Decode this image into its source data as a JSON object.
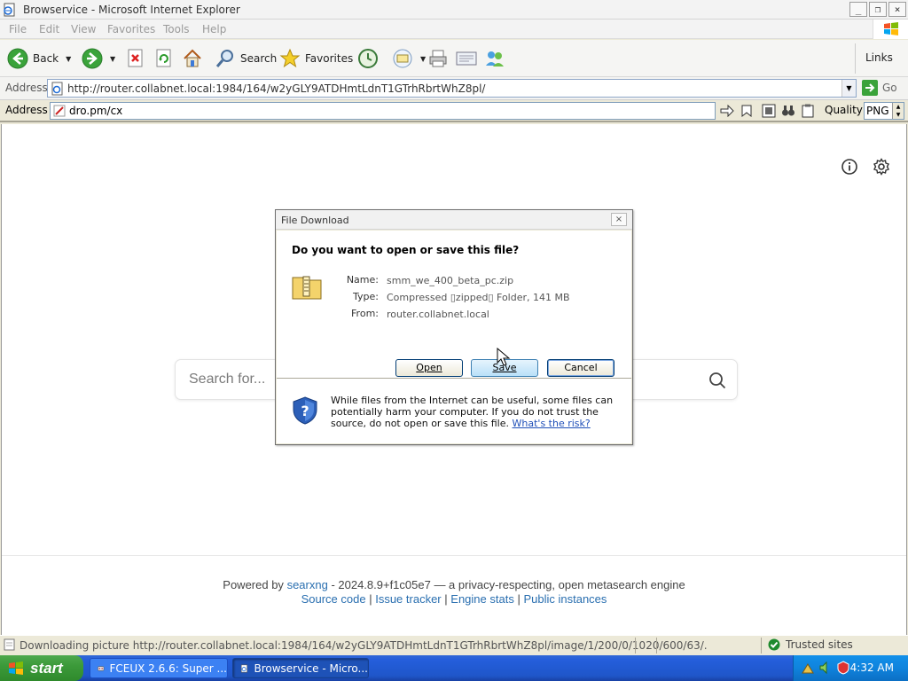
{
  "window": {
    "title": "Browservice - Microsoft Internet Explorer",
    "controls": {
      "minimize": "_",
      "restore": "❐",
      "close": "×"
    }
  },
  "menu": {
    "items": [
      "File",
      "Edit",
      "View",
      "Favorites",
      "Tools",
      "Help"
    ]
  },
  "toolbar": {
    "back_label": "Back",
    "search_label": "Search",
    "favorites_label": "Favorites",
    "links_label": "Links"
  },
  "address_bar": {
    "label": "Address",
    "url": "http://router.collabnet.local:1984/164/w2yGLY9ATDHmtLdnT1GTrhRbrtWhZ8pl/",
    "go_label": "Go"
  },
  "proxy_bar": {
    "label": "Address",
    "url": "dro.pm/cx",
    "quality_label": "Quality",
    "quality_value": "PNG"
  },
  "page": {
    "search_placeholder": "Search for...",
    "footer": {
      "powered_by": "Powered by",
      "engine_link": "searxng",
      "version_text": "- 2024.8.9+f1c05e7 — a privacy-respecting, open metasearch engine",
      "links": [
        "Source code",
        "Issue tracker",
        "Engine stats",
        "Public instances"
      ],
      "separator": "|"
    }
  },
  "dialog": {
    "title": "File Download",
    "question": "Do you want to open or save this file?",
    "fields": {
      "name_label": "Name:",
      "name_value": "smm_we_400_beta_pc.zip",
      "type_label": "Type:",
      "type_value": "Compressed ▯zipped▯ Folder, 141 MB",
      "from_label": "From:",
      "from_value": "router.collabnet.local"
    },
    "buttons": {
      "open": "Open",
      "save": "Save",
      "cancel": "Cancel"
    },
    "warning": "While files from the Internet can be useful, some files can potentially harm your computer. If you do not trust the source, do not open or save this file.",
    "risk_link": "What's the risk?"
  },
  "status_bar": {
    "text": "Downloading picture http://router.collabnet.local:1984/164/w2yGLY9ATDHmtLdnT1GTrhRbrtWhZ8pl/image/1/200/0/1020/600/63/.",
    "zone": "Trusted sites"
  },
  "taskbar": {
    "start_label": "start",
    "tasks": [
      {
        "label": "FCEUX 2.6.6: Super ..."
      },
      {
        "label": "Browservice - Micro..."
      }
    ],
    "clock": "4:32 AM"
  },
  "colors": {
    "taskbar_blue": "#245edb",
    "start_green": "#3c9a3a",
    "tray_blue": "#0f83dd",
    "link_blue": "#2a6fb0",
    "dialog_face": "#ece9d8"
  }
}
